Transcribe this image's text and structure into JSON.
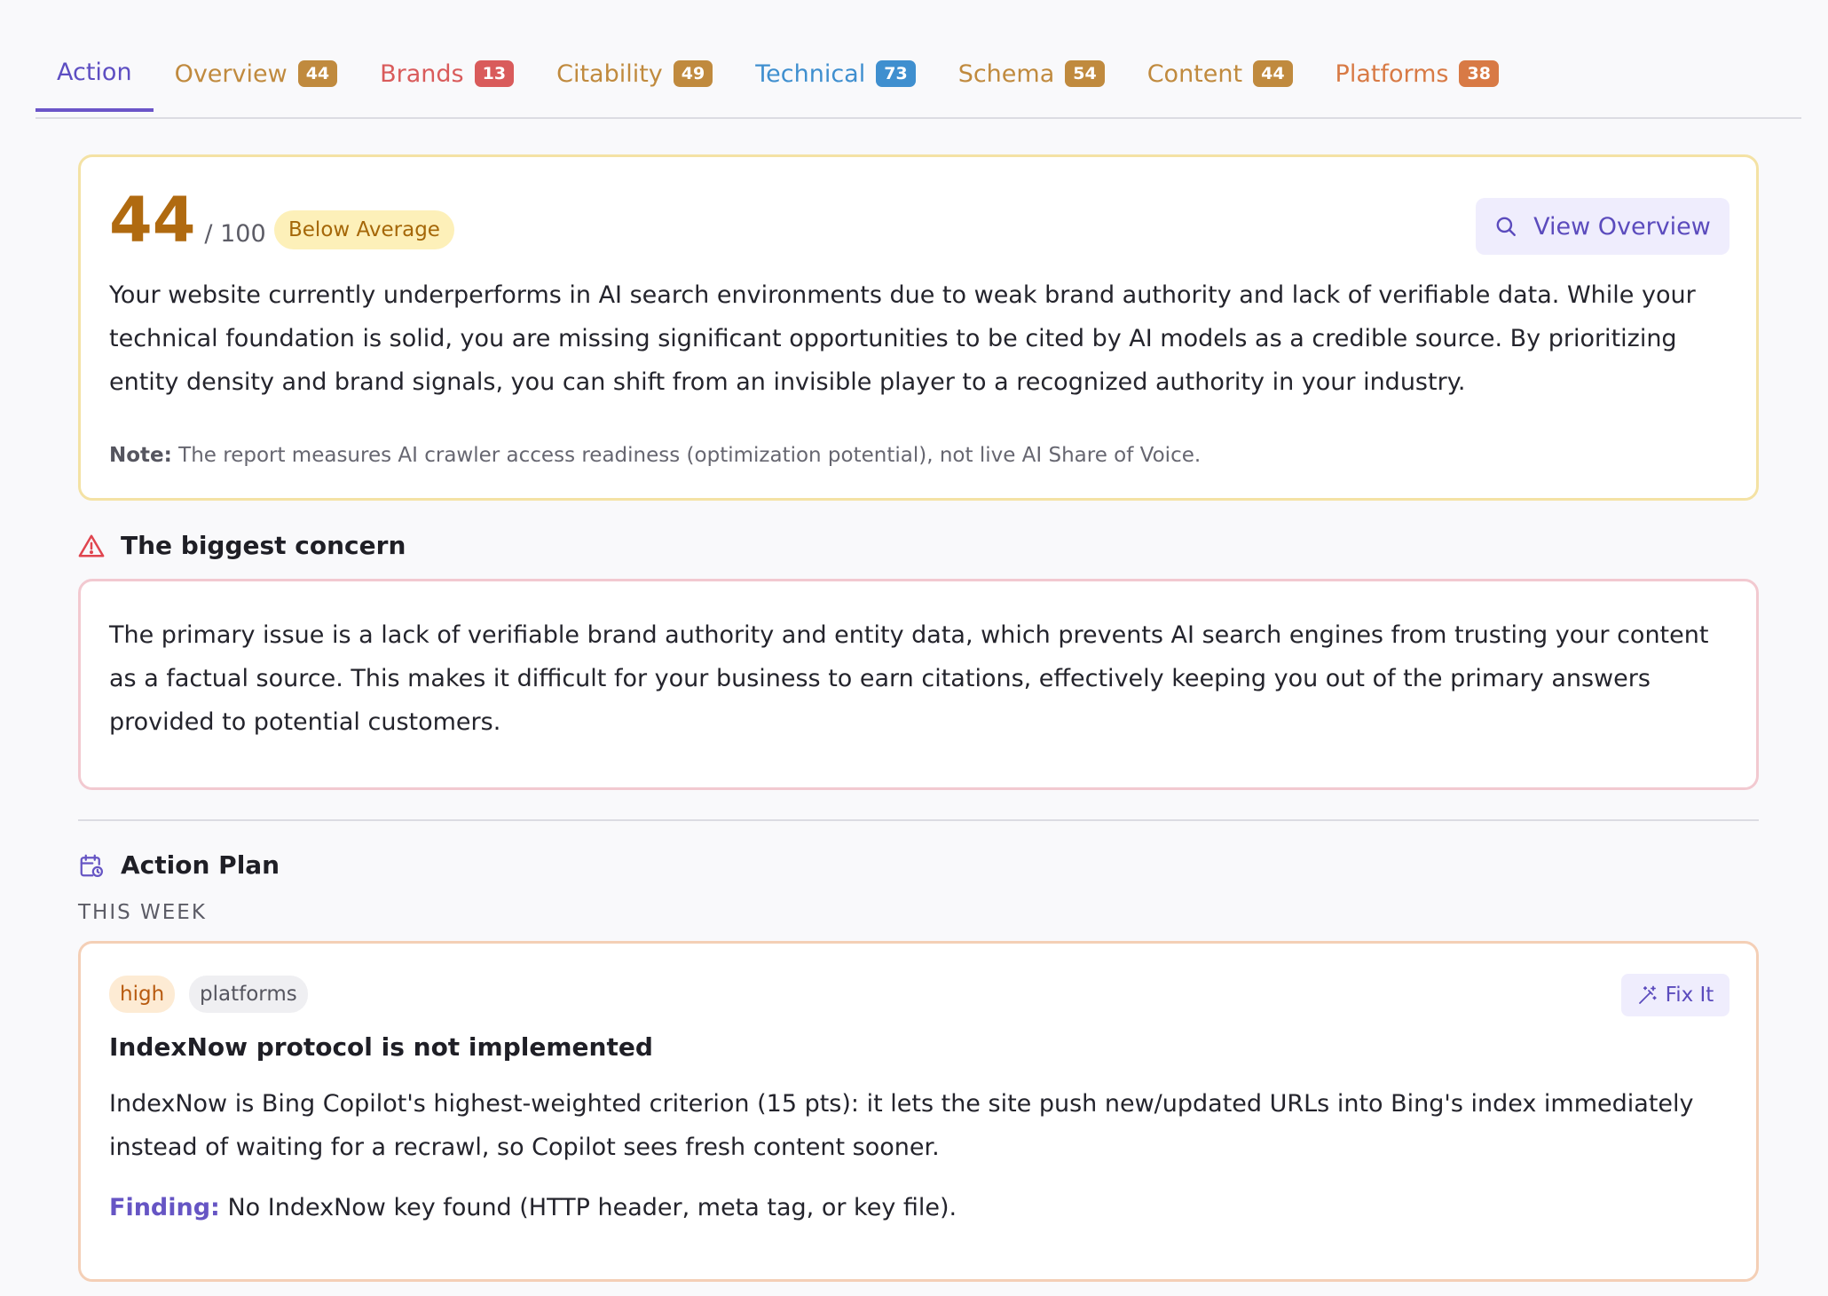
{
  "tabs": [
    {
      "label": "Action",
      "badge": null,
      "color": "#5d4ec2",
      "badge_color": null
    },
    {
      "label": "Overview",
      "badge": "44",
      "color": "#c08a3e",
      "badge_color": "#c08a3e"
    },
    {
      "label": "Brands",
      "badge": "13",
      "color": "#d95b5b",
      "badge_color": "#d95b5b"
    },
    {
      "label": "Citability",
      "badge": "49",
      "color": "#c08a3e",
      "badge_color": "#c08a3e"
    },
    {
      "label": "Technical",
      "badge": "73",
      "color": "#3f8fcf",
      "badge_color": "#3f8fcf"
    },
    {
      "label": "Schema",
      "badge": "54",
      "color": "#c08a3e",
      "badge_color": "#c08a3e"
    },
    {
      "label": "Content",
      "badge": "44",
      "color": "#c08a3e",
      "badge_color": "#c08a3e"
    },
    {
      "label": "Platforms",
      "badge": "38",
      "color": "#d87a45",
      "badge_color": "#d87a45"
    }
  ],
  "summary": {
    "score": "44",
    "score_max": "/ 100",
    "rating": "Below Average",
    "view_button": "View Overview",
    "text": "Your website currently underperforms in AI search environments due to weak brand authority and lack of verifiable data. While your technical foundation is solid, you are missing significant opportunities to be cited by AI models as a credible source. By prioritizing entity density and brand signals, you can shift from an invisible player to a recognized authority in your industry.",
    "note_label": "Note:",
    "note_text": "The report measures AI crawler access readiness (optimization potential), not live AI Share of Voice."
  },
  "concern": {
    "heading": "The biggest concern",
    "text": "The primary issue is a lack of verifiable brand authority and entity data, which prevents AI search engines from trusting your content as a factual source. This makes it difficult for your business to earn citations, effectively keeping you out of the primary answers provided to potential customers."
  },
  "plan": {
    "heading": "Action Plan",
    "period": "THIS WEEK",
    "task": {
      "priority": "high",
      "category": "platforms",
      "fix_button": "Fix It",
      "title": "IndexNow protocol is not implemented",
      "description": "IndexNow is Bing Copilot's highest-weighted criterion (15 pts): it lets the site push new/updated URLs into Bing's index immediately instead of waiting for a recrawl, so Copilot sees fresh content sooner.",
      "finding_label": "Finding:",
      "finding_text": "No IndexNow key found (HTTP header, meta tag, or key file)."
    }
  },
  "icons": {
    "view_button": "search-icon",
    "concern": "alert-triangle-icon",
    "plan": "calendar-clock-icon",
    "fix_button": "magic-wand-icon"
  }
}
